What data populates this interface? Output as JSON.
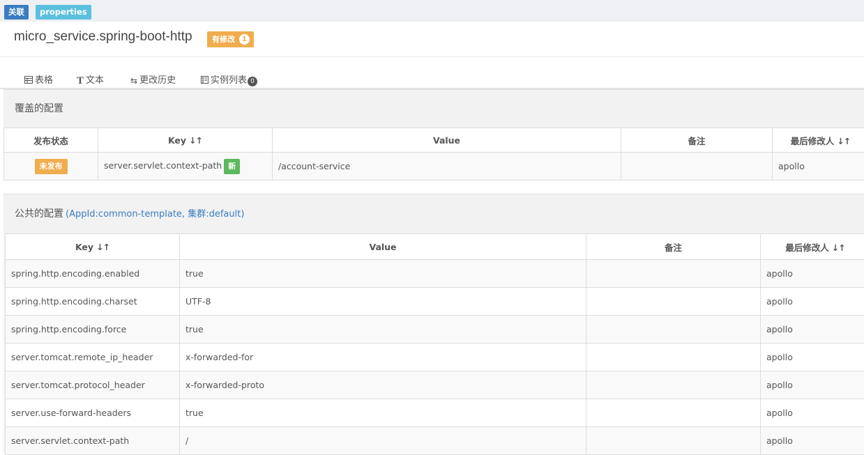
{
  "labels": {
    "link": "关联",
    "format": "properties"
  },
  "header": {
    "namespace": "micro_service.spring-boot-http",
    "modified_label": "有修改",
    "modified_count": "1"
  },
  "tabs": [
    {
      "label": "表格",
      "icon": "table-icon"
    },
    {
      "label": "文本",
      "icon": "text-icon"
    },
    {
      "label": "更改历史",
      "icon": "history-icon"
    },
    {
      "label": "实例列表",
      "icon": "instance-list-icon",
      "count": "0"
    }
  ],
  "override_section": {
    "title": "覆盖的配置",
    "columns": [
      "发布状态",
      "Key",
      "Value",
      "备注",
      "最后修改人"
    ],
    "rows": [
      {
        "status": "未发布",
        "key": "server.servlet.context-path",
        "new_label": "新",
        "value": "/account-service",
        "comment": "",
        "modifier": "apollo"
      }
    ]
  },
  "public_section": {
    "title": "公共的配置",
    "meta": "(AppId:common-template, 集群:default)",
    "columns": [
      "Key",
      "Value",
      "备注",
      "最后修改人"
    ],
    "rows": [
      {
        "key": "spring.http.encoding.enabled",
        "value": "true",
        "comment": "",
        "modifier": "apollo"
      },
      {
        "key": "spring.http.encoding.charset",
        "value": "UTF-8",
        "comment": "",
        "modifier": "apollo"
      },
      {
        "key": "spring.http.encoding.force",
        "value": "true",
        "comment": "",
        "modifier": "apollo"
      },
      {
        "key": "server.tomcat.remote_ip_header",
        "value": "x-forwarded-for",
        "comment": "",
        "modifier": "apollo"
      },
      {
        "key": "server.tomcat.protocol_header",
        "value": "x-forwarded-proto",
        "comment": "",
        "modifier": "apollo"
      },
      {
        "key": "server.use-forward-headers",
        "value": "true",
        "comment": "",
        "modifier": "apollo"
      },
      {
        "key": "server.servlet.context-path",
        "value": "/",
        "comment": "",
        "modifier": "apollo"
      }
    ]
  },
  "colors": {
    "primary": "#3a7cbf",
    "info": "#5bc0de",
    "warning": "#f0ad4e",
    "success": "#5cb85c"
  }
}
